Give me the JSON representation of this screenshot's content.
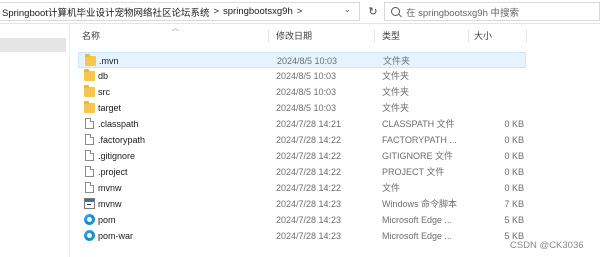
{
  "address": {
    "crumbs": [
      "Springboot计算机毕业设计宠物网络社区论坛系统",
      "springbootsxg9h"
    ],
    "separator": ">"
  },
  "search": {
    "placeholder": "在 springbootsxg9h 中搜索"
  },
  "columns": {
    "name": "名称",
    "date": "修改日期",
    "type": "类型",
    "size": "大小"
  },
  "rows": [
    {
      "name": ".mvn",
      "date": "2024/8/5 10:03",
      "type": "文件夹",
      "size": "",
      "icon": "folder-icon",
      "selected": true
    },
    {
      "name": "db",
      "date": "2024/8/5 10:03",
      "type": "文件夹",
      "size": "",
      "icon": "folder-icon"
    },
    {
      "name": "src",
      "date": "2024/8/5 10:03",
      "type": "文件夹",
      "size": "",
      "icon": "folder-icon"
    },
    {
      "name": "target",
      "date": "2024/8/5 10:03",
      "type": "文件夹",
      "size": "",
      "icon": "folder-icon"
    },
    {
      "name": ".classpath",
      "date": "2024/7/28 14:21",
      "type": "CLASSPATH 文件",
      "size": "0 KB",
      "icon": "file-icon"
    },
    {
      "name": ".factorypath",
      "date": "2024/7/28 14:22",
      "type": "FACTORYPATH ...",
      "size": "0 KB",
      "icon": "file-icon"
    },
    {
      "name": ".gitignore",
      "date": "2024/7/28 14:22",
      "type": "GITIGNORE 文件",
      "size": "0 KB",
      "icon": "file-icon"
    },
    {
      "name": ".project",
      "date": "2024/7/28 14:22",
      "type": "PROJECT 文件",
      "size": "0 KB",
      "icon": "file-icon"
    },
    {
      "name": "mvnw",
      "date": "2024/7/28 14:22",
      "type": "文件",
      "size": "0 KB",
      "icon": "file-icon"
    },
    {
      "name": "mvnw",
      "date": "2024/7/28 14:23",
      "type": "Windows 命令脚本",
      "size": "7 KB",
      "icon": "cmd-script-icon"
    },
    {
      "name": "pom",
      "date": "2024/7/28 14:23",
      "type": "Microsoft Edge ...",
      "size": "5 KB",
      "icon": "edge-icon"
    },
    {
      "name": "pom-war",
      "date": "2024/7/28 14:23",
      "type": "Microsoft Edge ...",
      "size": "5 KB",
      "icon": "edge-icon"
    }
  ],
  "watermark": "CSDN @CK3036"
}
